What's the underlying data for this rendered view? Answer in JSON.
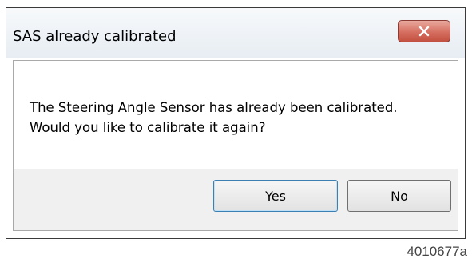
{
  "dialog": {
    "title": "SAS already calibrated",
    "close_icon": "close-icon",
    "message_line_1": "The Steering Angle Sensor has already been calibrated.",
    "message_line_2": "Would you like to calibrate it again?",
    "yes_label": "Yes",
    "no_label": "No"
  },
  "figure": {
    "id": "4010677a"
  },
  "colors": {
    "close_button": "#d56e60",
    "default_button_border": "#3c7fb1",
    "button_bar": "#f0f0f0"
  }
}
